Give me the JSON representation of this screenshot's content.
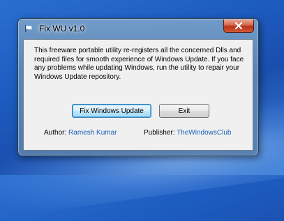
{
  "window": {
    "title": "Fix WU v1.0"
  },
  "description": "This freeware portable utility re-registers all the concerned Dlls and required files for smooth experience of Windows Update. If you face any problems while updating Windows, run the utility to repair your Windows Update repository.",
  "buttons": {
    "fix_label": "Fix Windows Update",
    "exit_label": "Exit"
  },
  "author": {
    "label": "Author:",
    "name": "Ramesh Kumar"
  },
  "publisher": {
    "label": "Publisher:",
    "name": "TheWindowsClub"
  },
  "colors": {
    "link": "#1a5fb4",
    "close_button": "#c7462a",
    "desktop": "#1d5cc0"
  },
  "icons": [
    "app-flag-icon",
    "close-icon"
  ]
}
